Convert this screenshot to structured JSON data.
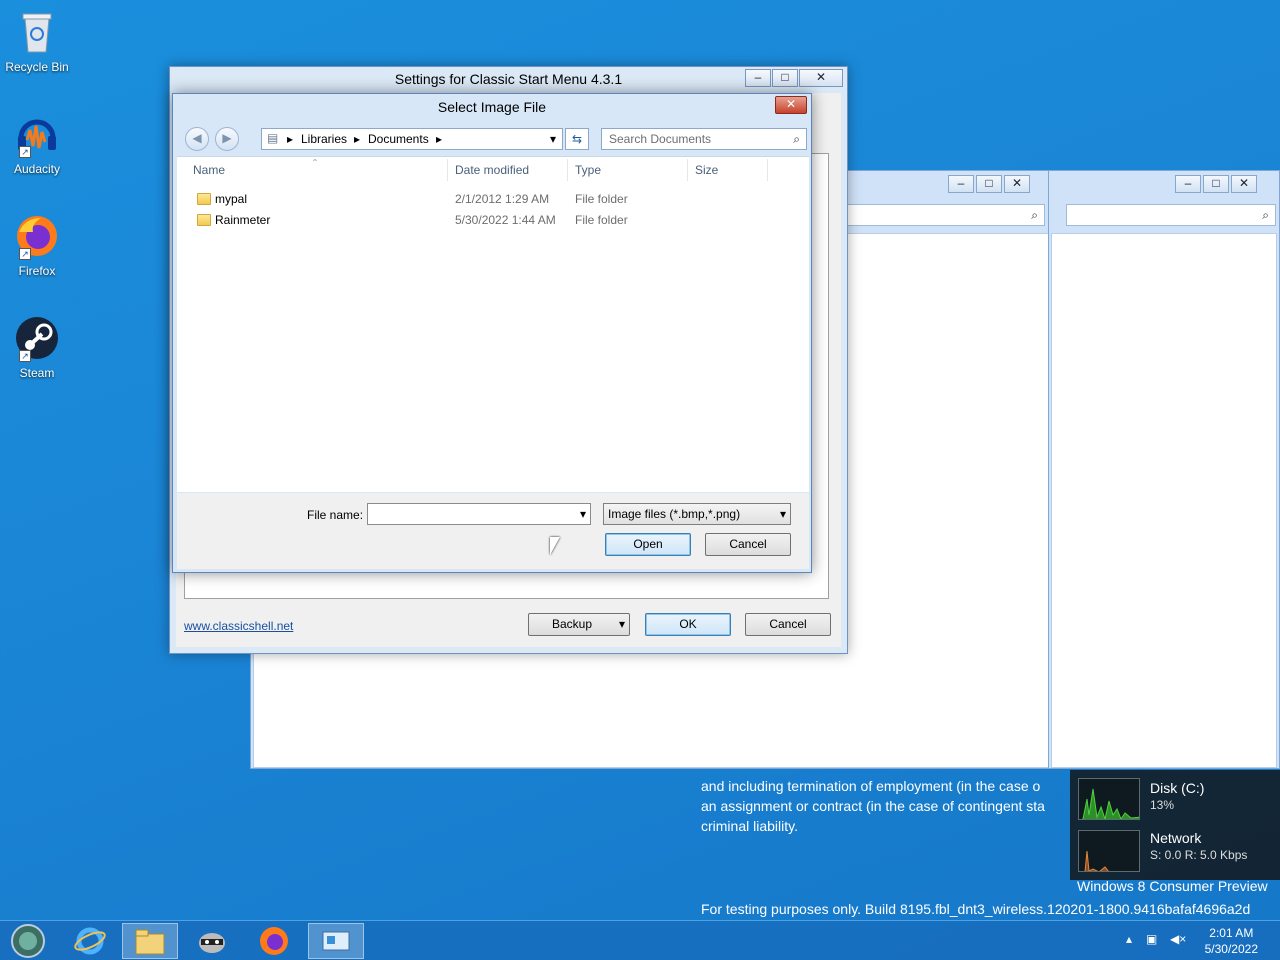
{
  "desktop": {
    "icons": [
      {
        "label": "Recycle Bin",
        "icon": "recycle-bin-icon"
      },
      {
        "label": "Audacity",
        "icon": "audacity-icon"
      },
      {
        "label": "Firefox",
        "icon": "firefox-icon"
      },
      {
        "label": "Steam",
        "icon": "steam-icon"
      }
    ],
    "watermark": {
      "para1_line1": "and including termination of employment (in the case o",
      "para1_line2": "an assignment or contract (in the case of contingent sta",
      "para1_line3": "criminal liability.",
      "edition": "Windows 8 Consumer Preview",
      "build": "For testing purposes only. Build 8195.fbl_dnt3_wireless.120201-1800.9416bafaf4696a2d"
    }
  },
  "gadget": {
    "disk_label": "Disk (C:)",
    "disk_value": "13%",
    "network_label": "Network",
    "network_value": "S: 0.0 R: 5.0 Kbps",
    "colors": {
      "disk_graph": "#4fd13c",
      "network_graph": "#e8863a"
    }
  },
  "settings_window": {
    "title": "Settings for Classic Start Menu 4.3.1",
    "controls": {
      "minimize": "–",
      "maximize": "□",
      "close": "✕"
    },
    "link": "www.classicshell.net",
    "backup_label": "Backup",
    "ok_label": "OK",
    "cancel_label": "Cancel"
  },
  "dialog": {
    "title": "Select Image File",
    "close": "✕",
    "breadcrumb": [
      "Libraries",
      "Documents"
    ],
    "search_placeholder": "Search Documents",
    "columns": {
      "name": "Name",
      "date": "Date modified",
      "type": "Type",
      "size": "Size"
    },
    "files": [
      {
        "name": "mypal",
        "date": "2/1/2012 1:29 AM",
        "type": "File folder"
      },
      {
        "name": "Rainmeter",
        "date": "5/30/2022 1:44 AM",
        "type": "File folder"
      }
    ],
    "filename_label": "File name:",
    "filename_value": "",
    "filter_value": "Image files (*.bmp,*.png)",
    "open_label": "Open",
    "cancel_label": "Cancel"
  },
  "taskbar": {
    "items": [
      "start-orb",
      "internet-explorer",
      "file-explorer",
      "raccoon-app",
      "firefox",
      "control-panel"
    ],
    "time": "2:01 AM",
    "date": "5/30/2022",
    "accent": "#1a6ec0"
  }
}
